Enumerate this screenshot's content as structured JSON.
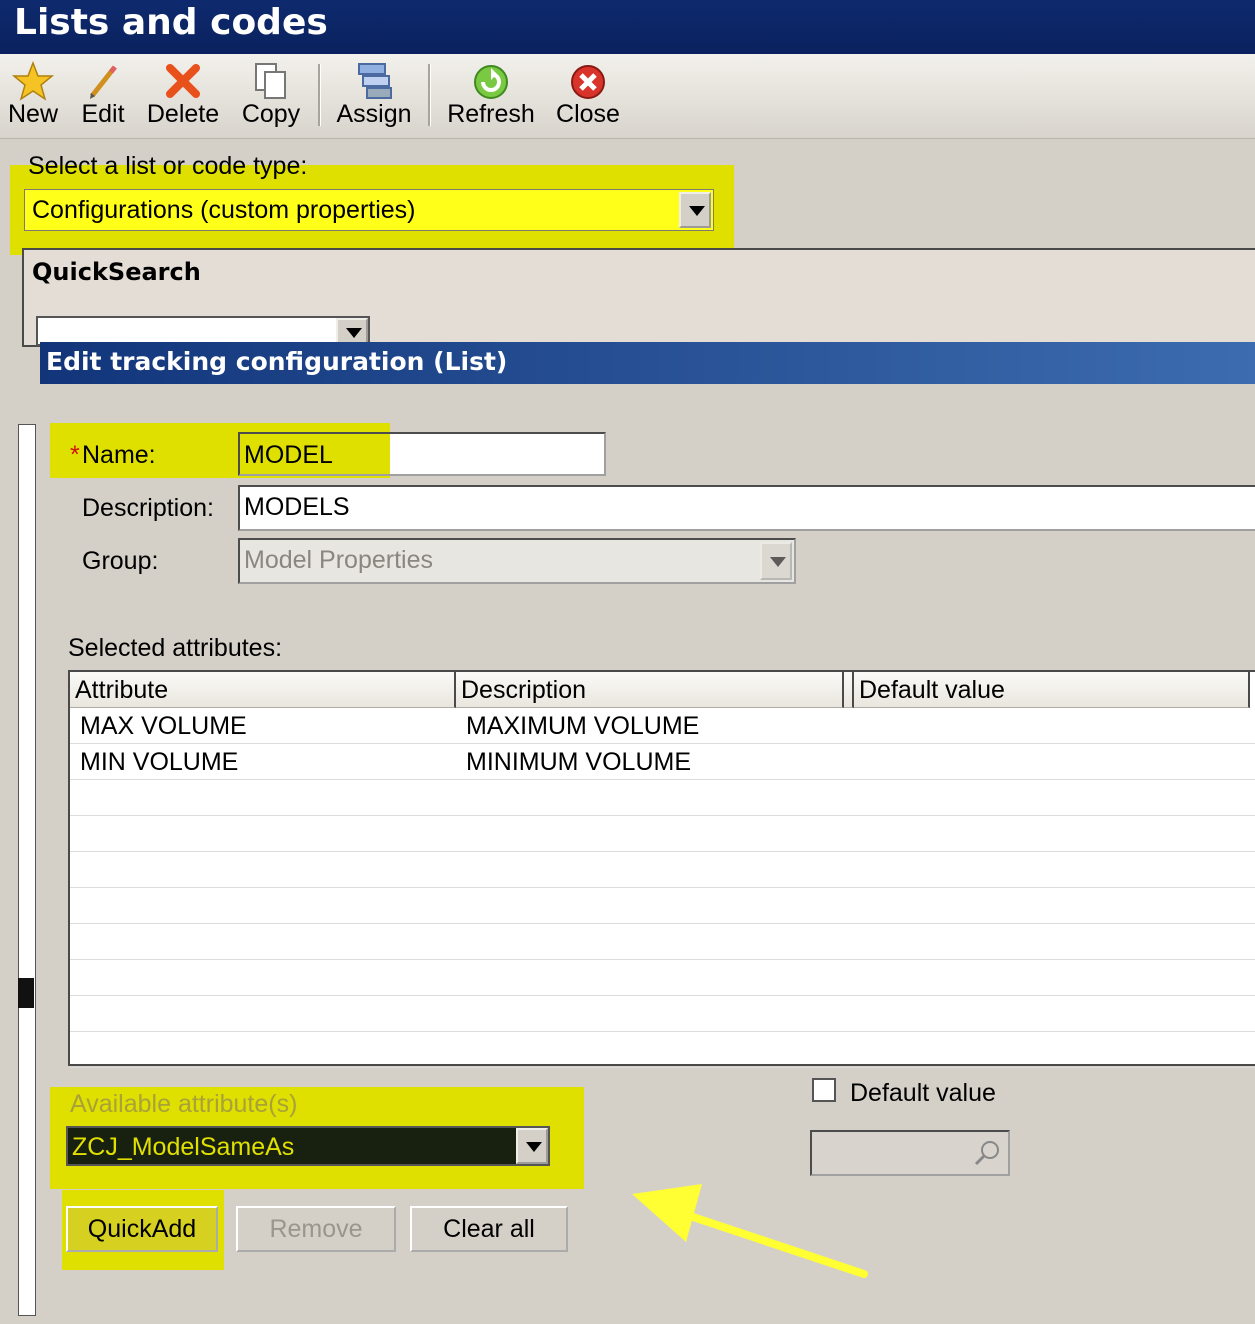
{
  "window": {
    "title": "Lists and codes"
  },
  "toolbar": {
    "new_label": "New",
    "edit_label": "Edit",
    "delete_label": "Delete",
    "copy_label": "Copy",
    "assign_label": "Assign",
    "refresh_label": "Refresh",
    "close_label": "Close"
  },
  "selector": {
    "label": "Select a list or code type:",
    "value": "Configurations (custom properties)"
  },
  "quicksearch": {
    "title": "QuickSearch"
  },
  "dialog": {
    "title": "Edit tracking configuration (List)",
    "name_required_mark": "*",
    "name_label": "Name:",
    "name_value": "MODEL",
    "description_label": "Description:",
    "description_value": "MODELS",
    "group_label": "Group:",
    "group_value": "Model Properties",
    "selected_attributes_label": "Selected attributes:",
    "table": {
      "columns": [
        "Attribute",
        "Description",
        "Default value"
      ],
      "rows": [
        {
          "attribute": "MAX VOLUME",
          "description": "MAXIMUM VOLUME",
          "default": ""
        },
        {
          "attribute": "MIN VOLUME",
          "description": "MINIMUM VOLUME",
          "default": ""
        }
      ]
    },
    "available_label": "Available attribute(s)",
    "available_value": "ZCJ_ModelSameAs",
    "default_value_checkbox_label": "Default value",
    "default_value_checked": false,
    "buttons": {
      "quickadd": "QuickAdd",
      "remove": "Remove",
      "clear_all": "Clear all"
    }
  },
  "colors": {
    "highlight": "#e0e000",
    "title_bar": "#0e2a6e",
    "dialog_title": "#12357a",
    "annotation_arrow": "#ffff33"
  },
  "icons": [
    "star-icon",
    "pencil-icon",
    "red-x-icon",
    "copy-pages-icon",
    "assign-icon",
    "refresh-icon",
    "close-circle-icon",
    "dropdown-arrow-icon",
    "magnifier-icon",
    "annotation-arrow"
  ]
}
